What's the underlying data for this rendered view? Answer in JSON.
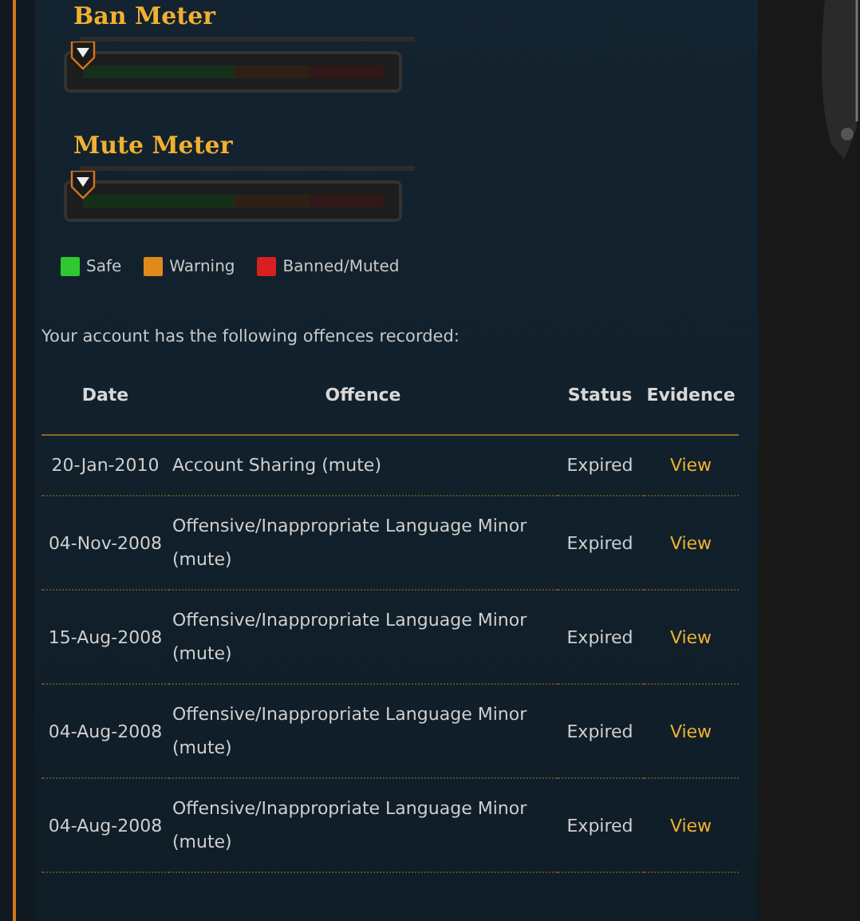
{
  "meters": [
    {
      "title": "Ban Meter",
      "level": 0
    },
    {
      "title": "Mute Meter",
      "level": 0
    }
  ],
  "legend": [
    {
      "label": "Safe",
      "color": "#2ec92e"
    },
    {
      "label": "Warning",
      "color": "#e08a1c"
    },
    {
      "label": "Banned/Muted",
      "color": "#d82020"
    }
  ],
  "intro": "Your account has the following offences recorded:",
  "table": {
    "columns": [
      "Date",
      "Offence",
      "Status",
      "Evidence"
    ],
    "rows": [
      {
        "date": "20-Jan-2010",
        "offence": "Account Sharing (mute)",
        "status": "Expired",
        "evidence": "View"
      },
      {
        "date": "04-Nov-2008",
        "offence": "Offensive/Inappropriate Language Minor (mute)",
        "status": "Expired",
        "evidence": "View"
      },
      {
        "date": "15-Aug-2008",
        "offence": "Offensive/Inappropriate Language Minor (mute)",
        "status": "Expired",
        "evidence": "View"
      },
      {
        "date": "04-Aug-2008",
        "offence": "Offensive/Inappropriate Language Minor (mute)",
        "status": "Expired",
        "evidence": "View"
      },
      {
        "date": "04-Aug-2008",
        "offence": "Offensive/Inappropriate Language Minor (mute)",
        "status": "Expired",
        "evidence": "View"
      }
    ]
  }
}
